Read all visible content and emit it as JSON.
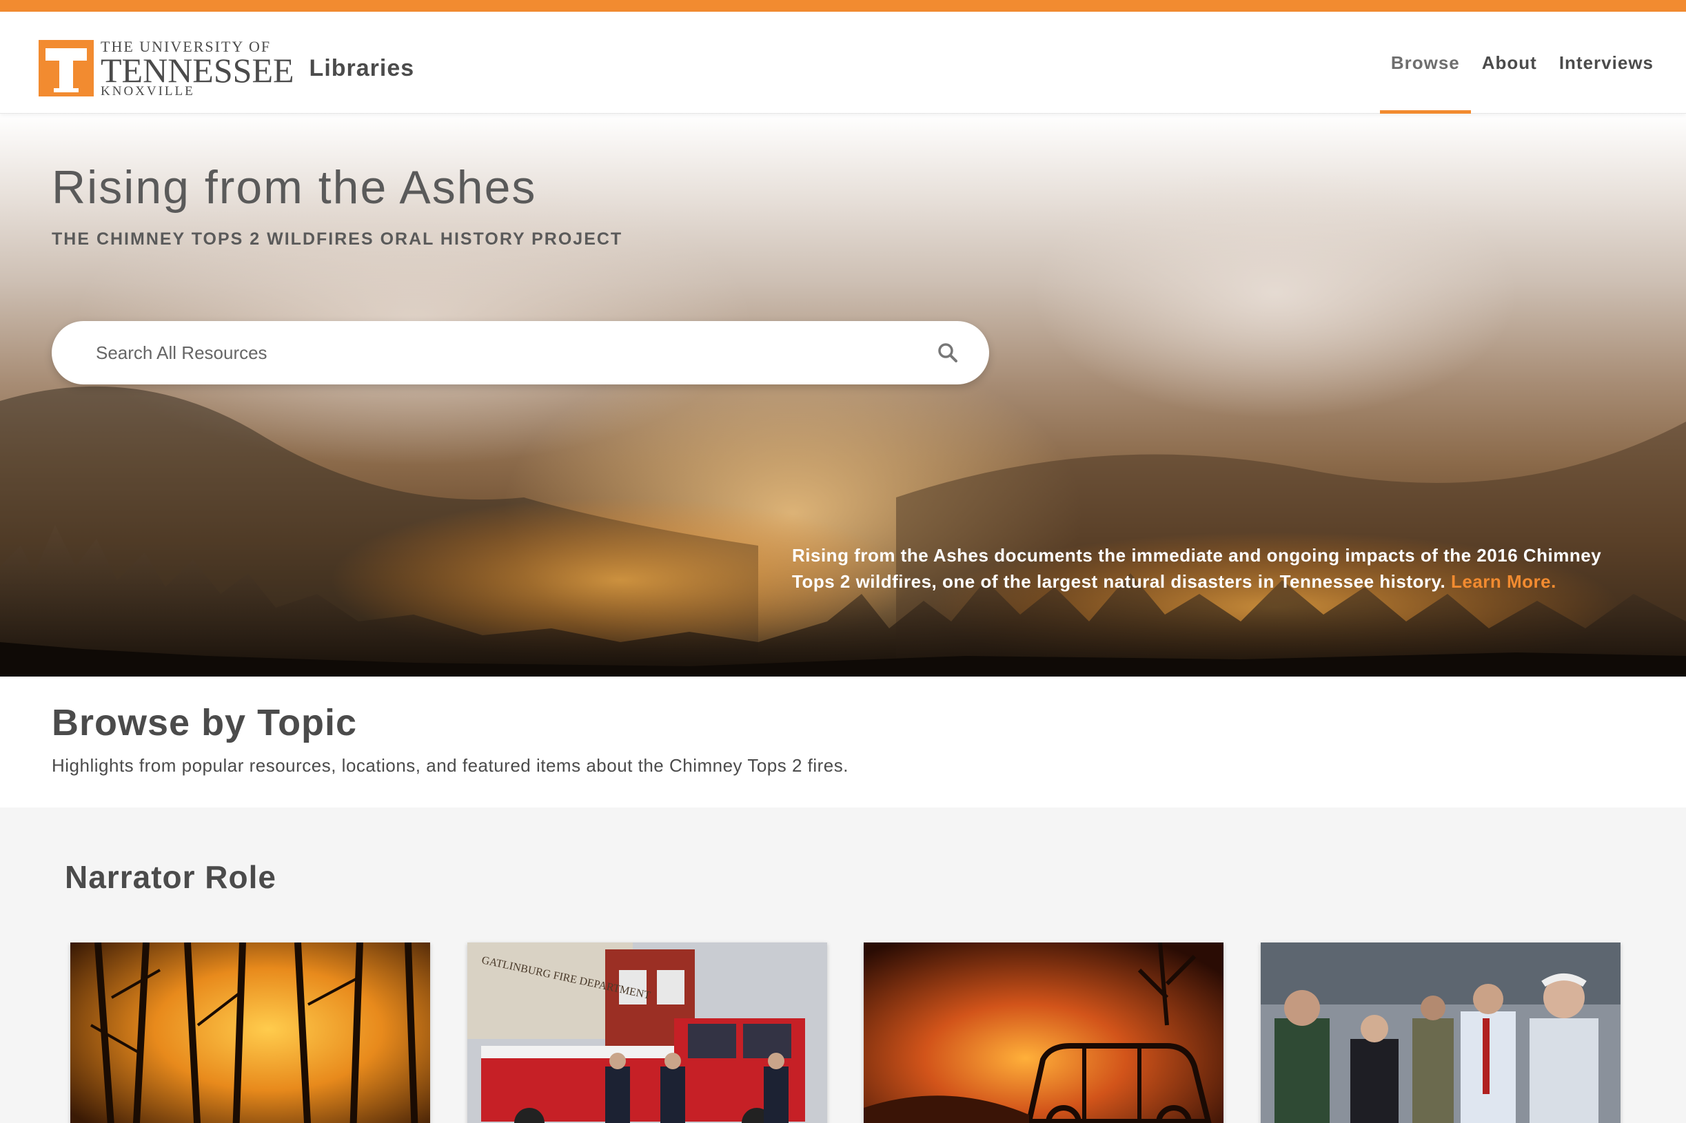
{
  "header": {
    "logo": {
      "line1": "THE UNIVERSITY OF",
      "line2": "TENNESSEE",
      "line3": "KNOXVILLE",
      "mark": "T",
      "brand_color": "#f28b30"
    },
    "site_name": "Libraries",
    "nav": [
      {
        "label": "Browse",
        "active": true
      },
      {
        "label": "About",
        "active": false
      },
      {
        "label": "Interviews",
        "active": false
      }
    ]
  },
  "hero": {
    "title": "Rising from the Ashes",
    "subtitle": "THE CHIMNEY TOPS 2 WILDFIRES ORAL HISTORY PROJECT",
    "search": {
      "placeholder": "Search All Resources",
      "icon": "search-icon"
    },
    "description": "Rising from the Ashes documents the immediate and ongoing impacts of the 2016 Chimney Tops 2 wildfires, one of the largest natural disasters in Tennessee history.",
    "learn_more": "Learn More."
  },
  "browse": {
    "title": "Browse by Topic",
    "subtitle": "Highlights from popular resources, locations, and featured items about the Chimney Tops 2 fires."
  },
  "section": {
    "title": "Narrator Role",
    "cards": [
      {
        "image": "forest-fire-at-night"
      },
      {
        "image": "gatlinburg-fire-department",
        "sign_text": "GATLINBURG FIRE DEPARTMENT"
      },
      {
        "image": "burned-vehicle"
      },
      {
        "image": "officials-group"
      }
    ]
  },
  "colors": {
    "accent": "#f28b30",
    "text": "#4b4b4b",
    "section_bg": "#f5f5f5"
  }
}
